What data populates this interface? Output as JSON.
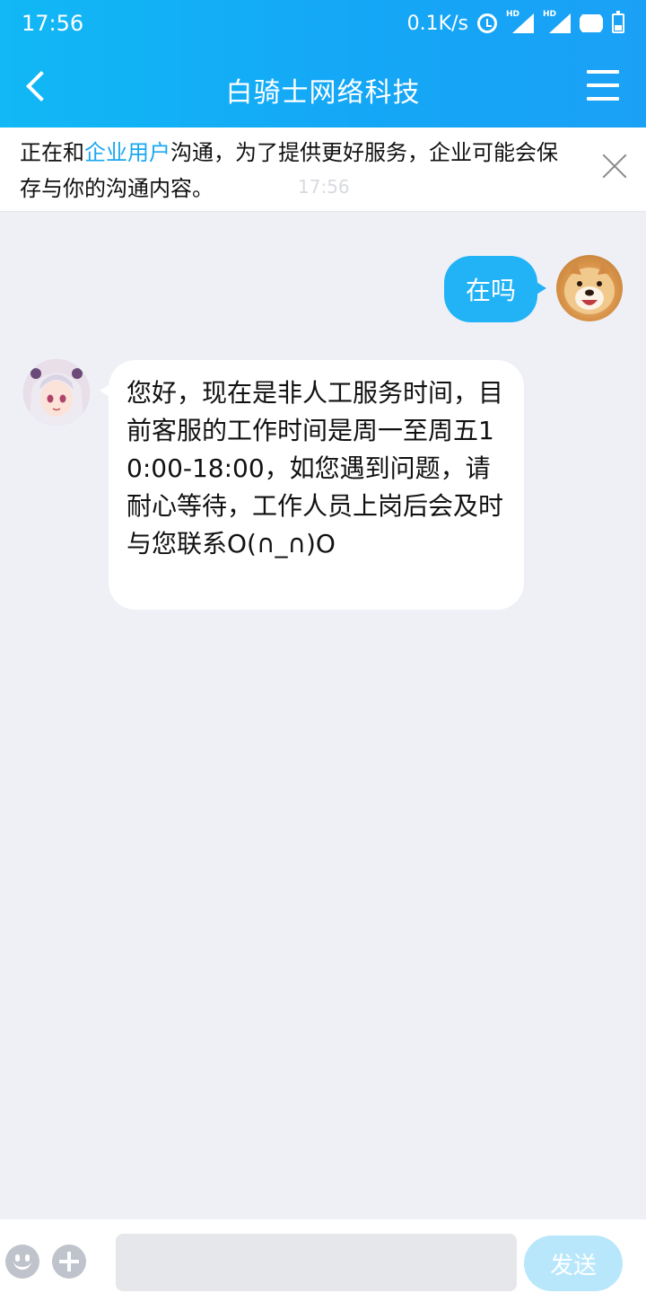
{
  "status_bar": {
    "time": "17:56",
    "network_speed": "0.1K/s",
    "icons": [
      "alarm-icon",
      "signal-hd-icon",
      "signal-hd-icon",
      "wifi-icon",
      "battery-icon"
    ],
    "hd_label": "HD"
  },
  "nav": {
    "title": "白骑士网络科技",
    "back_icon": "chevron-left-icon",
    "menu_icon": "hamburger-menu-icon"
  },
  "notice": {
    "prefix": "正在和",
    "highlight": "企业用户",
    "suffix": "沟通，为了提供更好服务，企业可能会保存与你的沟通内容。",
    "close_icon": "close-icon",
    "faint_time": "17:56"
  },
  "messages": [
    {
      "sender": "me",
      "text": "在吗"
    },
    {
      "sender": "agent",
      "text": "您好，现在是非人工服务时间，目前客服的工作时间是周一至周五10:00-18:00，如您遇到问题，请耐心等待，工作人员上岗后会及时与您联系O(∩_∩)O"
    }
  ],
  "input_bar": {
    "input_value": "",
    "send_label": "发送",
    "emoji_icon": "emoji-icon",
    "plus_icon": "plus-icon"
  },
  "colors": {
    "header_gradient_start": "#11b8f5",
    "header_gradient_end": "#1aa1f6",
    "outgoing_bubble": "#22b3f7",
    "highlight_text": "#1aa7f2",
    "send_button": "#b8e7fb",
    "background": "#eef0f6"
  }
}
